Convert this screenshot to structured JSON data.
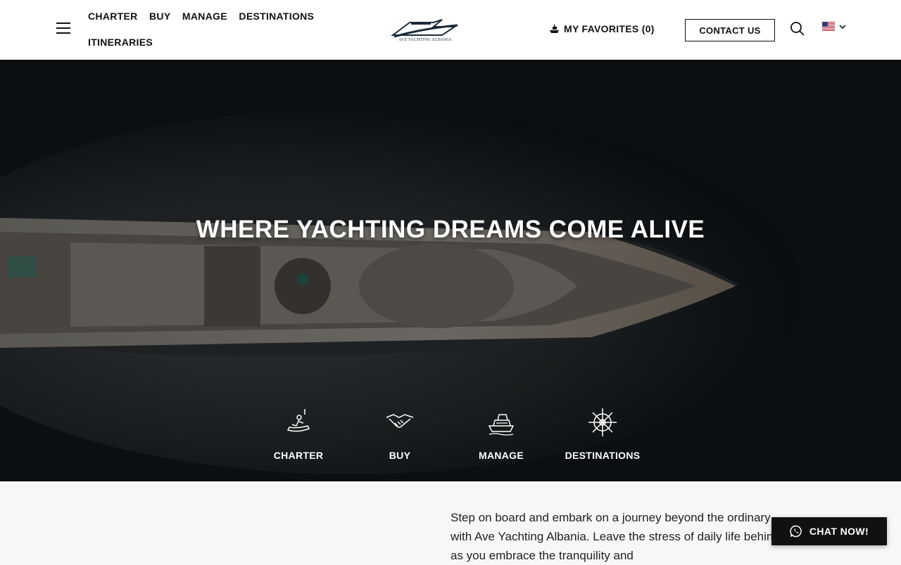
{
  "header": {
    "nav": [
      "CHARTER",
      "BUY",
      "MANAGE",
      "DESTINATIONS",
      "ITINERARIES"
    ],
    "logo_text": "AVE YACHTING ALBANIA",
    "favorites": "MY FAVORITES (0)",
    "contact": "CONTACT US",
    "language": "en-us-flag"
  },
  "hero": {
    "title": "WHERE YACHTING DREAMS COME ALIVE",
    "services": [
      {
        "label": "CHARTER",
        "icon": "jet-ski-icon"
      },
      {
        "label": "BUY",
        "icon": "handshake-icon"
      },
      {
        "label": "MANAGE",
        "icon": "yacht-icon"
      },
      {
        "label": "DESTINATIONS",
        "icon": "ship-wheel-icon"
      }
    ]
  },
  "intro": {
    "text": "Step on board and embark on a journey beyond the ordinary with Ave Yachting Albania. Leave the stress of daily life behind as you embrace the tranquility and"
  },
  "chat": {
    "label": "CHAT NOW!"
  },
  "colors": {
    "text": "#111111",
    "hero_bg": "#0e1417",
    "content_bg": "#f7f7f7",
    "logo": "#1c2b38"
  }
}
